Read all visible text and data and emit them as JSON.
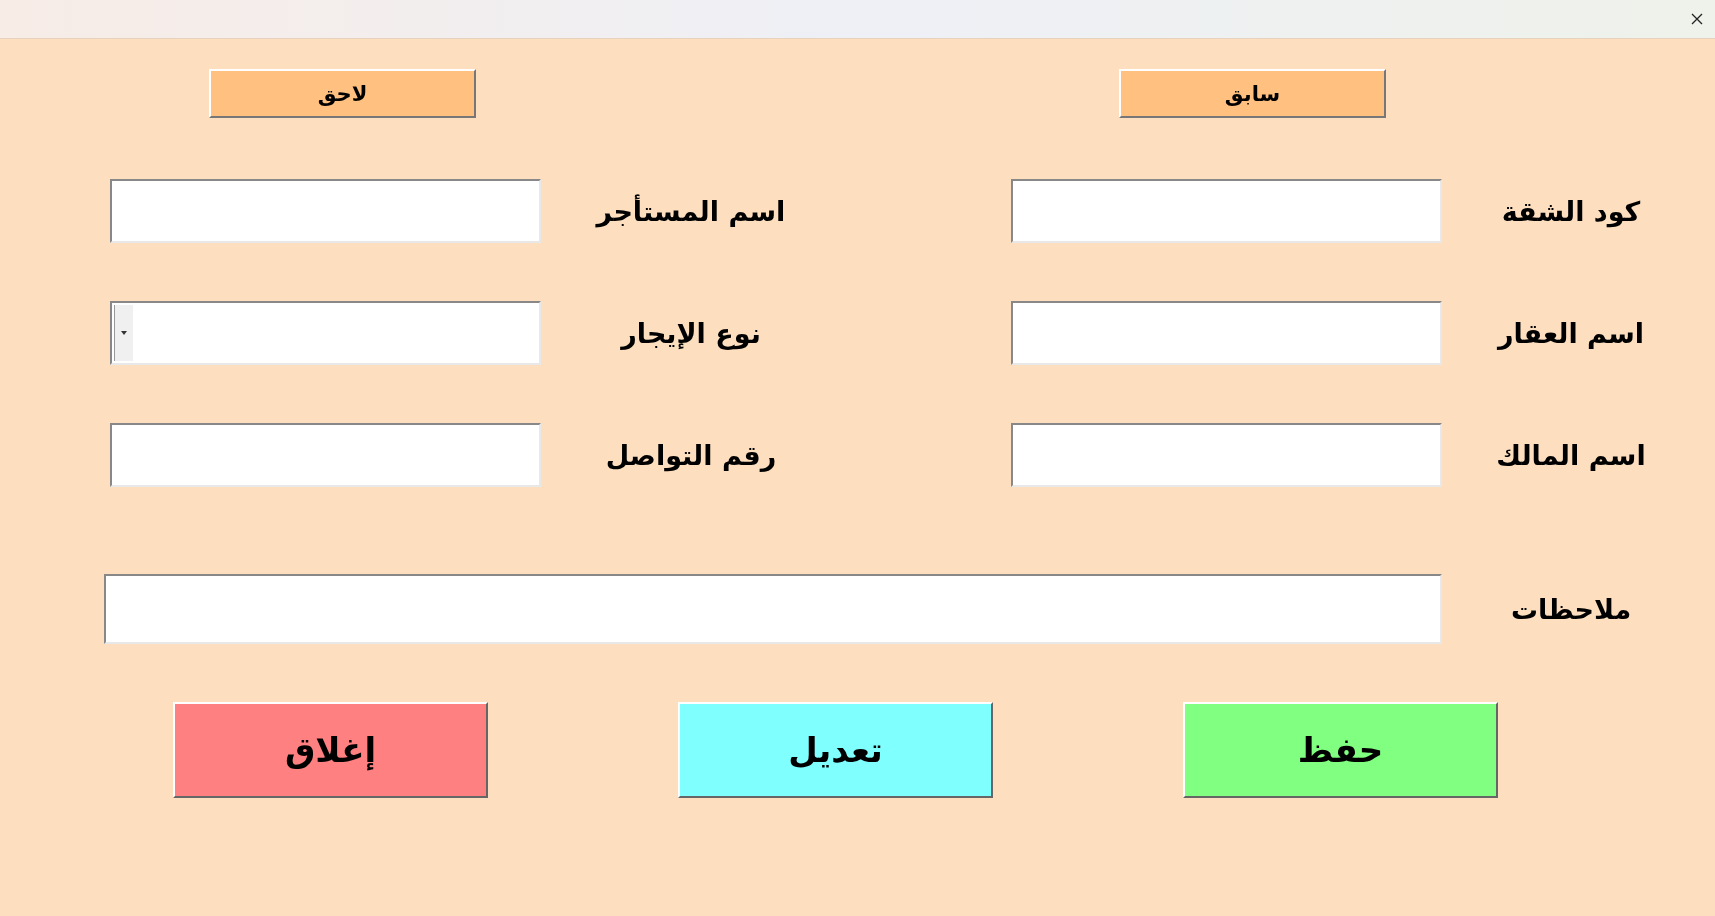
{
  "nav_buttons": [
    {
      "label": "سابق"
    },
    {
      "label": "لاحق"
    }
  ],
  "rows": [
    {
      "fields": [
        {
          "label": "كود الشقة",
          "kind": "text"
        },
        {
          "label": "اسم المستأجر",
          "kind": "text"
        }
      ]
    },
    {
      "fields": [
        {
          "label": "اسم العقار",
          "kind": "text"
        },
        {
          "label": "نوع الإيجار",
          "kind": "dropdown"
        }
      ]
    },
    {
      "fields": [
        {
          "label": "اسم المالك",
          "kind": "text"
        },
        {
          "label": "رقم التواصل",
          "kind": "text"
        }
      ]
    }
  ],
  "notes": {
    "label": "ملاحظات"
  },
  "actions": [
    {
      "label": "حفظ",
      "color": "#80ff80"
    },
    {
      "label": "تعديل",
      "color": "#80ffff"
    },
    {
      "label": "إغلاق",
      "color": "#ff8080"
    }
  ]
}
